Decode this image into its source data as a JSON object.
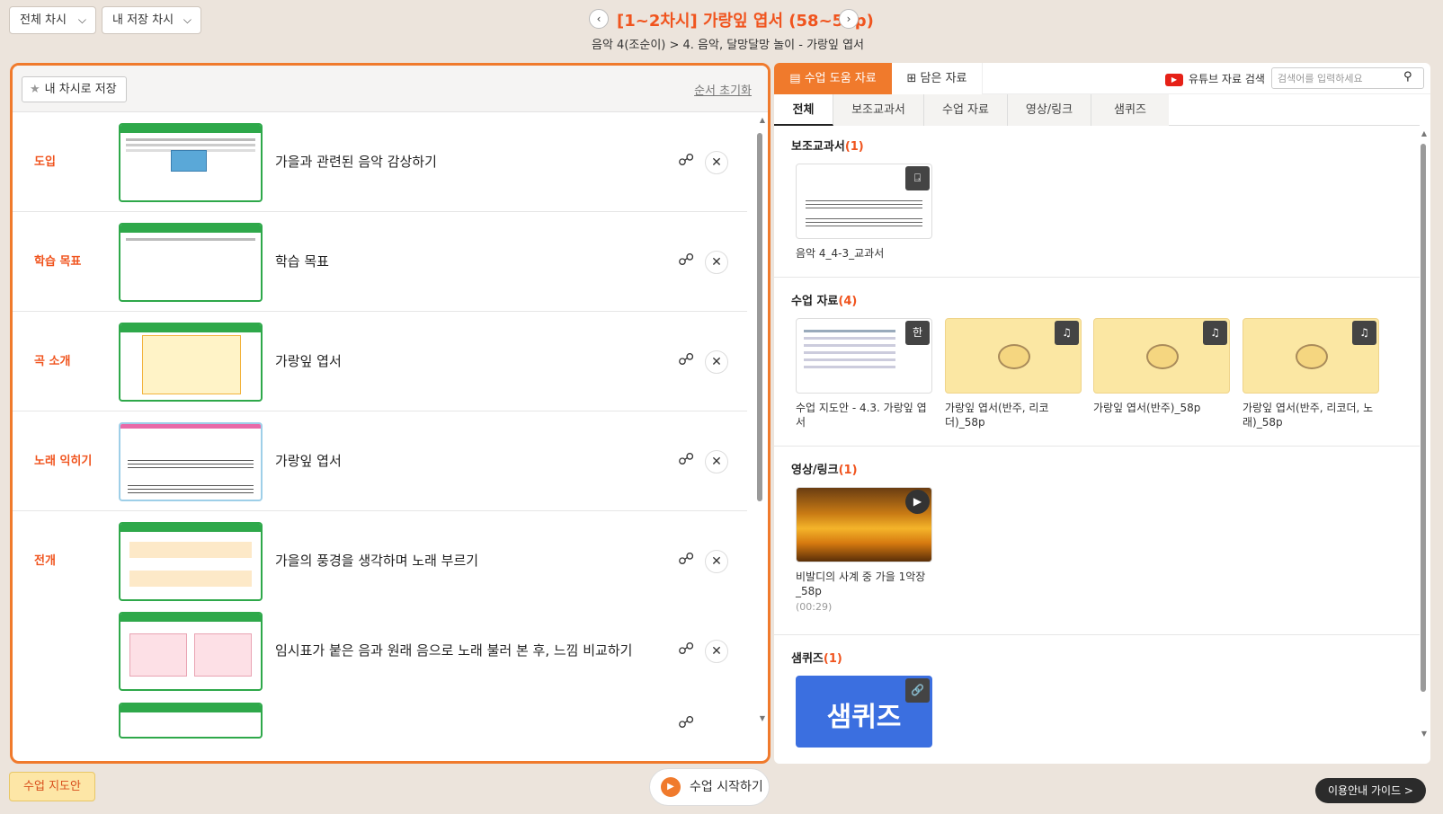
{
  "top": {
    "select_all": "전체 차시",
    "select_mine": "내 저장 차시",
    "title": "[1~2차시] 가랑잎 엽서 (58~59p)",
    "breadcrumb": "음악 4(조순이)  >  4. 음악, 달망달망 놀이 - 가랑잎 엽서"
  },
  "left": {
    "save_label": "내 차시로 저장",
    "reset_label": "순서 초기화",
    "rows": [
      {
        "stage": "도입",
        "text": "가을과 관련된 음악 감상하기"
      },
      {
        "stage": "학습 목표",
        "text": "학습 목표"
      },
      {
        "stage": "곡 소개",
        "text": "가랑잎 엽서"
      },
      {
        "stage": "노래 익히기",
        "text": "가랑잎 엽서"
      },
      {
        "stage": "전개",
        "text": "가을의 풍경을 생각하며 노래 부르기"
      },
      {
        "stage": "",
        "text": "임시표가 붙은 음과 원래 음으로 노래 불러 본 후, 느낌 비교하기"
      }
    ]
  },
  "right": {
    "tab_help": "수업 도움 자료",
    "tab_saved": "담은 자료",
    "youtube_label": "유튜브 자료 검색",
    "search_placeholder": "검색어를 입력하세요",
    "subtabs": [
      "전체",
      "보조교과서",
      "수업 자료",
      "영상/링크",
      "샘퀴즈"
    ],
    "sections": {
      "aux": {
        "title": "보조교과서",
        "count": "(1)",
        "items": [
          {
            "title": "음악 4_4-3_교과서"
          }
        ]
      },
      "class": {
        "title": "수업 자료",
        "count": "(4)",
        "items": [
          {
            "title": "수업 지도안 - 4.3. 가랑잎 엽서"
          },
          {
            "title": "가랑잎 엽서(반주, 리코더)_58p"
          },
          {
            "title": "가랑잎 엽서(반주)_58p"
          },
          {
            "title": "가랑잎 엽서(반주, 리코더, 노래)_58p"
          }
        ]
      },
      "video": {
        "title": "영상/링크",
        "count": "(1)",
        "items": [
          {
            "title": "비발디의 사계 중 가을 1악장_58p",
            "duration": "(00:29)"
          }
        ]
      },
      "quiz": {
        "title": "샘퀴즈",
        "count": "(1)",
        "logo": "샘퀴즈"
      }
    }
  },
  "bottom": {
    "guide_plan": "수업 지도안",
    "start_class": "수업 시작하기",
    "usage_guide": "이용안내 가이드 >"
  },
  "colors": {
    "accent": "#f07a2c",
    "title": "#f0541e",
    "green": "#2ea84a"
  }
}
